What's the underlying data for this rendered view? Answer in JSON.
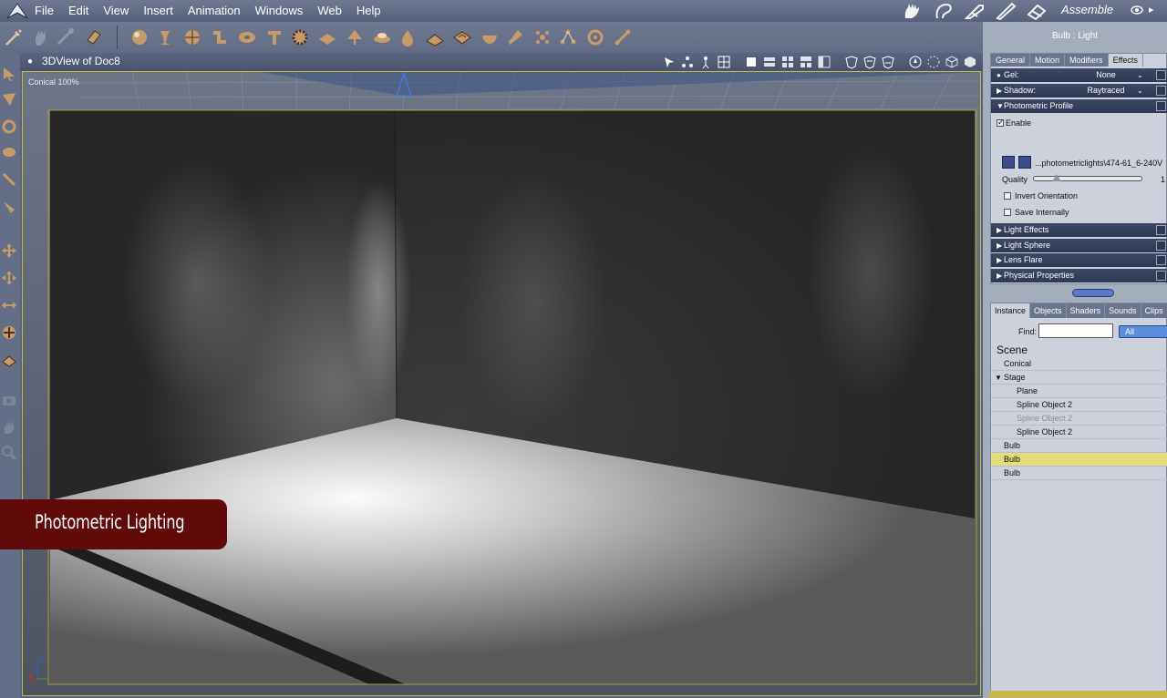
{
  "menubar": {
    "items": [
      "File",
      "Edit",
      "View",
      "Insert",
      "Animation",
      "Windows",
      "Web",
      "Help"
    ],
    "room": "Assemble",
    "room_icons": [
      "hand-pose-room-icon",
      "face-room-icon",
      "hair-room-icon",
      "cloth-room-icon",
      "material-room-icon"
    ]
  },
  "toolbar": {
    "tools": [
      "interaction-icon",
      "hand-icon",
      "bone-icon",
      "link-icon",
      "sphere-icon",
      "goblet-icon",
      "globe-icon",
      "pipe-icon",
      "torus-icon",
      "text-icon",
      "gear-icon",
      "plane-icon",
      "tree-icon",
      "cloud-icon",
      "drop-icon",
      "terrain-icon",
      "bowl-icon",
      "lamp-icon",
      "particles-icon",
      "nodes-icon",
      "ring-icon",
      "bone2-icon"
    ]
  },
  "view": {
    "title": "3DView of Doc8",
    "camera_label": "Conical 100%",
    "axis_labels": [
      "Z",
      "X"
    ]
  },
  "caption": {
    "text": "Photometric Lighting"
  },
  "properties": {
    "title": "Bulb : Light",
    "tabs": [
      "General",
      "Motion",
      "Modifiers",
      "Effects"
    ],
    "active_tab": "Effects",
    "gel": {
      "label": "Gel:",
      "value": "None"
    },
    "shadow": {
      "label": "Shadow:",
      "value": "Raytraced"
    },
    "photometric": {
      "label": "Photometric Profile",
      "enable_label": "Enable",
      "file": "...photometriclights\\474-61_6-240V",
      "quality_label": "Quality",
      "quality_value": "1",
      "invert_label": "Invert Orientation",
      "save_label": "Save Internally"
    },
    "sections": [
      "Light Effects",
      "Light Sphere",
      "Lens Flare",
      "Physical Properties"
    ]
  },
  "library": {
    "tabs": [
      "Instance",
      "Objects",
      "Shaders",
      "Sounds",
      "Clips"
    ],
    "active_tab": "Instance",
    "find_label": "Find:",
    "find_value": "",
    "filter": "All",
    "scene_label": "Scene",
    "tree": [
      {
        "label": "Conical",
        "indent": 0,
        "state": "normal"
      },
      {
        "label": "Stage",
        "indent": 0,
        "state": "normal",
        "expanded": true
      },
      {
        "label": "Plane",
        "indent": 2,
        "state": "normal"
      },
      {
        "label": "Spline Object 2",
        "indent": 2,
        "state": "normal"
      },
      {
        "label": "Spline Object 2",
        "indent": 2,
        "state": "dim"
      },
      {
        "label": "Spline Object 2",
        "indent": 2,
        "state": "normal"
      },
      {
        "label": "Bulb",
        "indent": 0,
        "state": "normal"
      },
      {
        "label": "Bulb",
        "indent": 0,
        "state": "selected"
      },
      {
        "label": "Bulb",
        "indent": 0,
        "state": "normal"
      }
    ]
  },
  "colors": {
    "menubar": "#626c84",
    "panel": "#a4adbc",
    "section_header": "#2e3852",
    "selection": "#e3dc7a",
    "caption_bg": "#600a0a"
  }
}
